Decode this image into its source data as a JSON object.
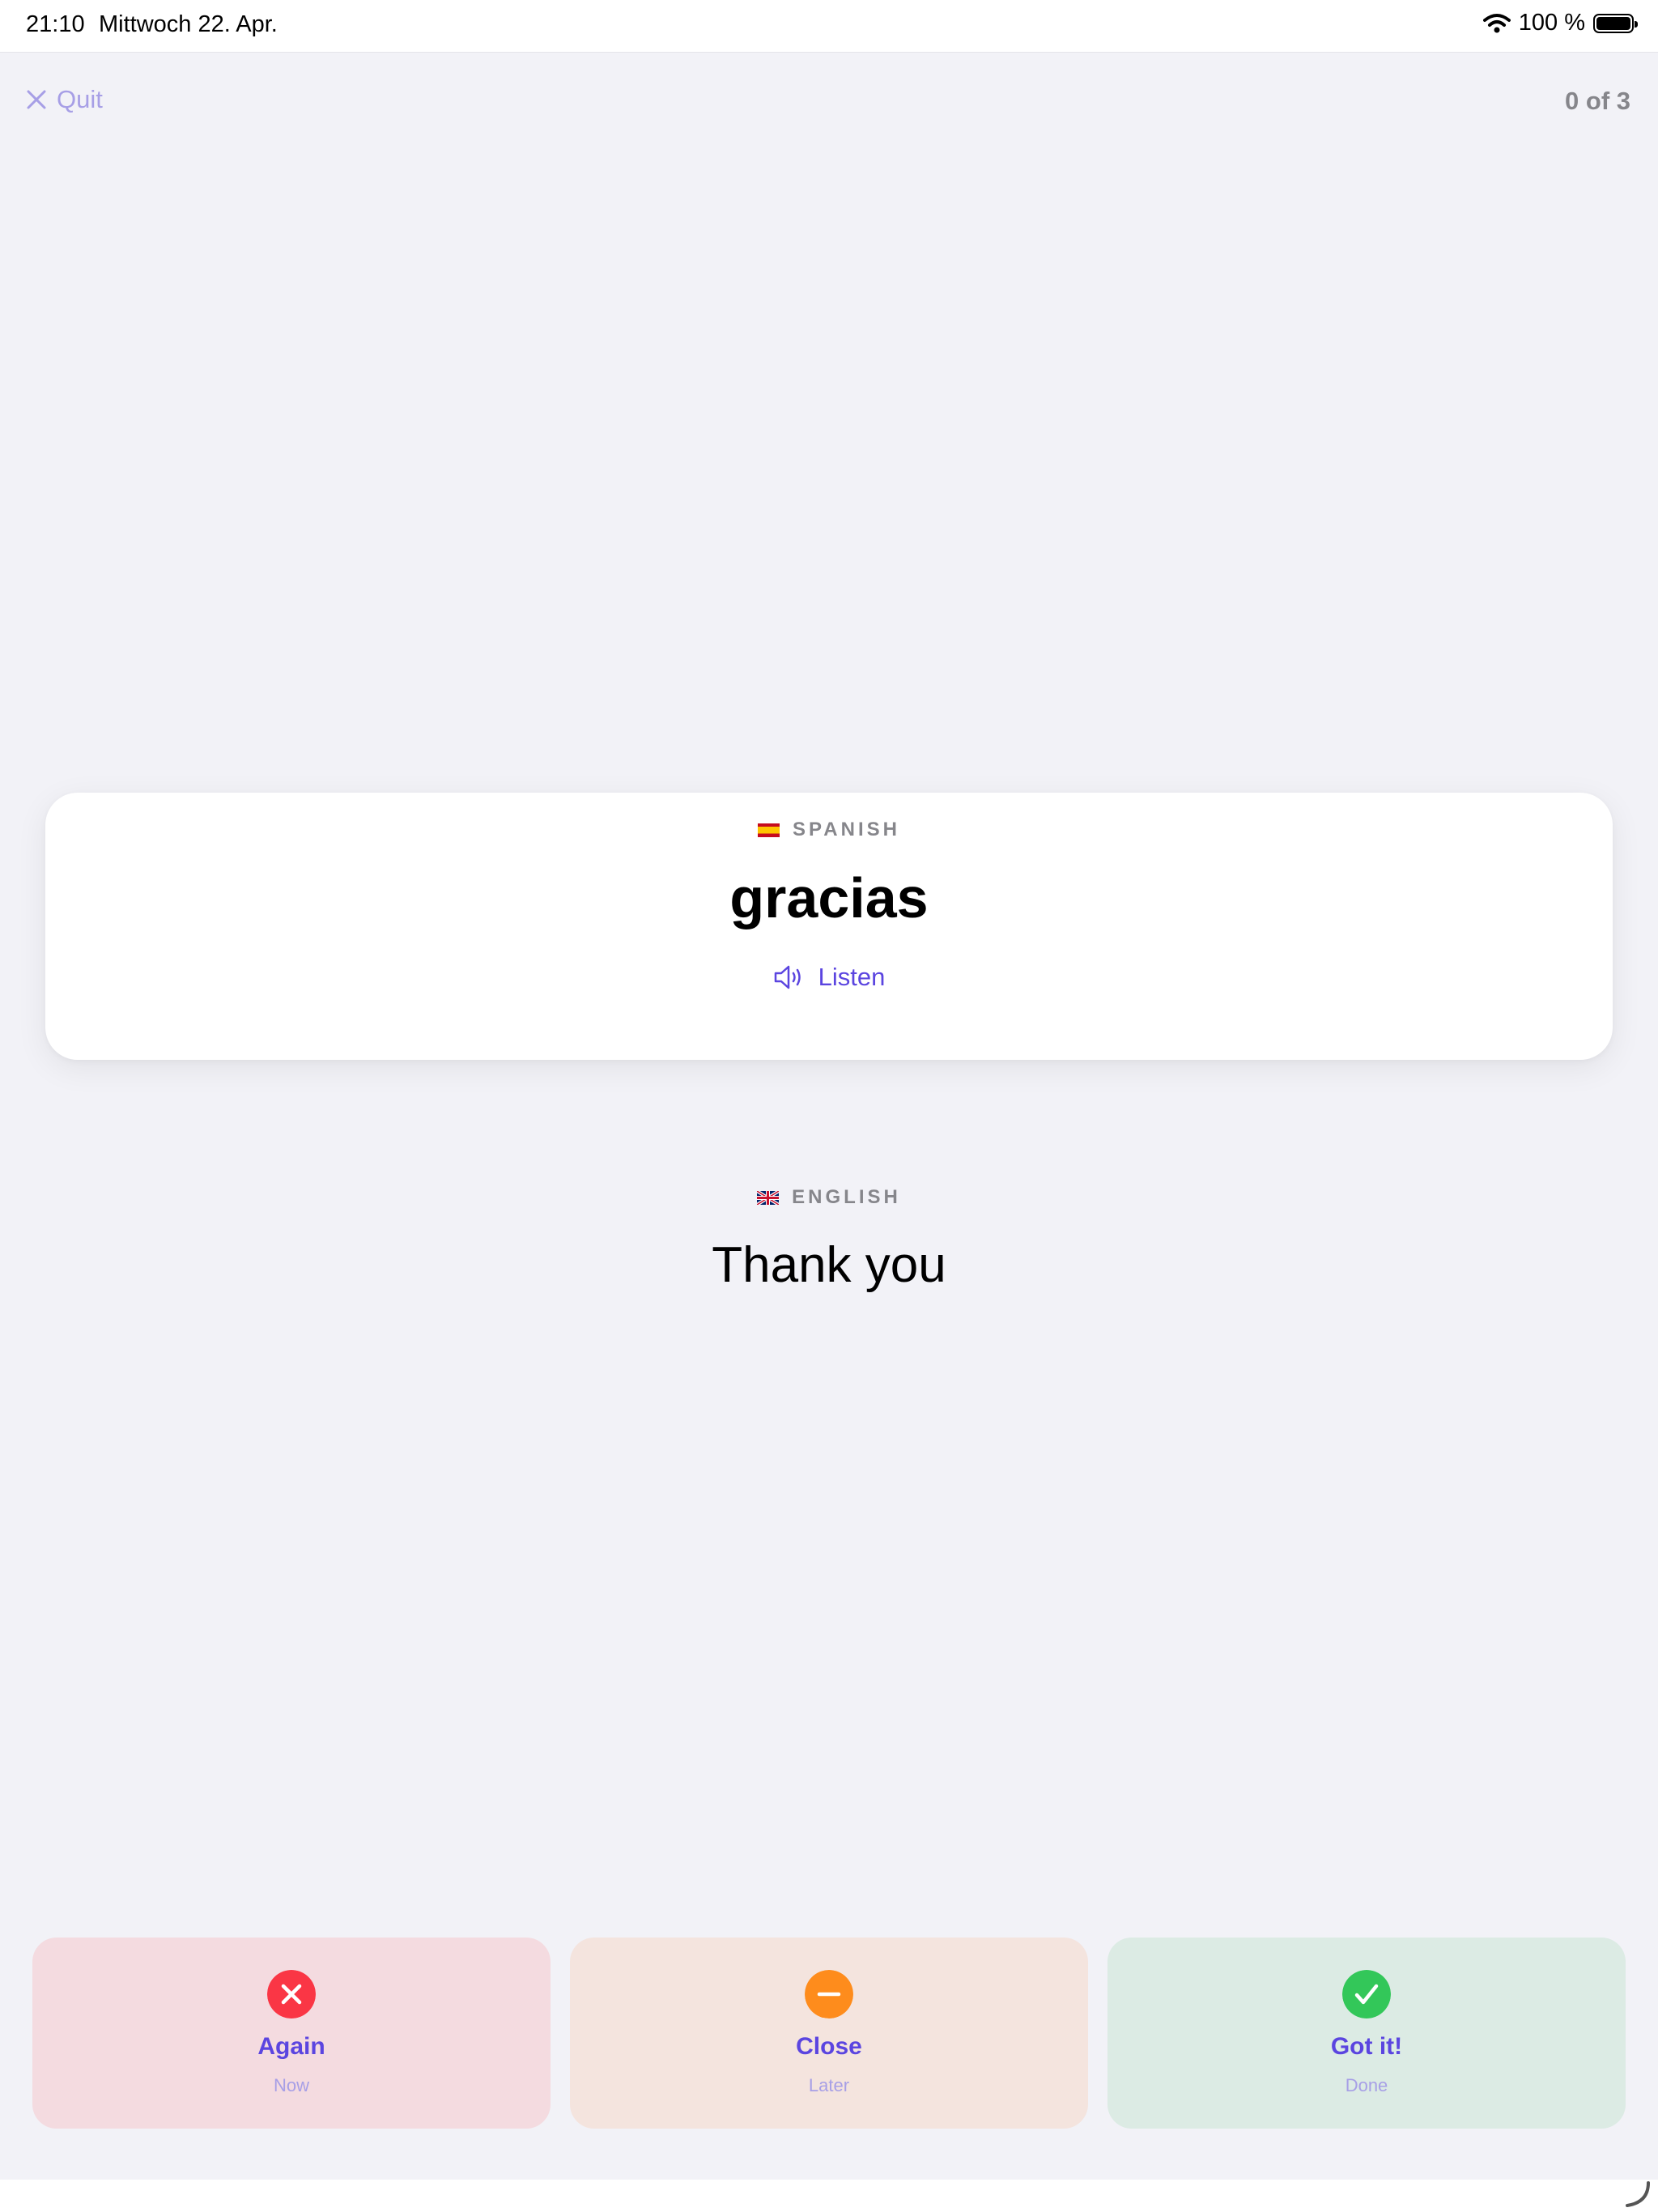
{
  "status_bar": {
    "time": "21:10",
    "date": "Mittwoch 22. Apr.",
    "battery": "100 %"
  },
  "header": {
    "quit_label": "Quit",
    "progress": "0 of 3"
  },
  "card": {
    "language": "SPANISH",
    "flag": "spain-flag",
    "word": "gracias",
    "listen_label": "Listen"
  },
  "translation": {
    "language": "ENGLISH",
    "flag": "uk-flag",
    "text": "Thank you"
  },
  "answers": [
    {
      "label": "Again",
      "sub": "Now",
      "icon": "x-circle-icon",
      "color": "#fa3645"
    },
    {
      "label": "Close",
      "sub": "Later",
      "icon": "minus-circle-icon",
      "color": "#fe8c1c"
    },
    {
      "label": "Got it!",
      "sub": "Done",
      "icon": "check-circle-icon",
      "color": "#33c759"
    }
  ],
  "colors": {
    "accent": "#5b45e0",
    "accent_light": "#a79fe6",
    "background": "#f2f2f7"
  }
}
